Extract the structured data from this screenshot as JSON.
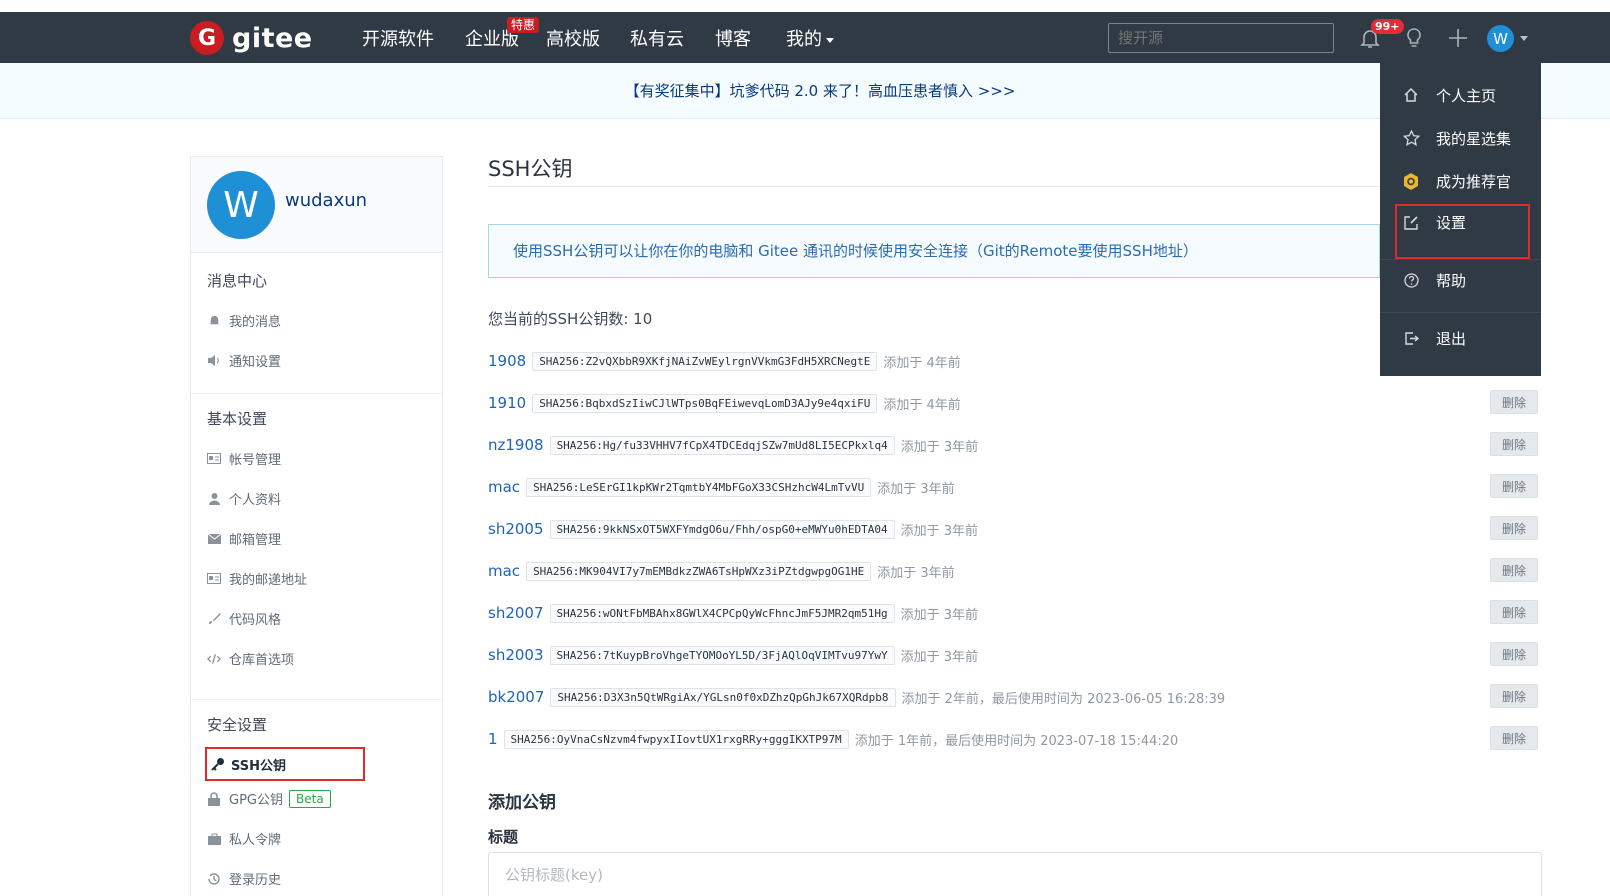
{
  "nav": {
    "logo_mark": "G",
    "logo_text": "gitee",
    "items": [
      "开源软件",
      "企业版",
      "高校版",
      "私有云",
      "博客",
      "我的"
    ],
    "hot_badge": "特惠",
    "search_placeholder": "搜开源",
    "notification_count": "99+",
    "avatar_letter": "W"
  },
  "promo": {
    "text": "【有奖征集中】坑爹代码 2.0 来了！高血压患者慎入 >>>"
  },
  "sidebar": {
    "avatar_letter": "W",
    "username": "wudaxun",
    "sections": [
      {
        "title": "消息中心",
        "items": [
          "我的消息",
          "通知设置"
        ]
      },
      {
        "title": "基本设置",
        "items": [
          "帐号管理",
          "个人资料",
          "邮箱管理",
          "我的邮递地址",
          "代码风格",
          "仓库首选项"
        ]
      },
      {
        "title": "安全设置",
        "items": [
          "SSH公钥",
          "GPG公钥",
          "私人令牌",
          "登录历史"
        ]
      }
    ],
    "beta_label": "Beta"
  },
  "main": {
    "title": "SSH公钥",
    "info": "使用SSH公钥可以让你在你的电脑和 Gitee 通讯的时候使用安全连接（Git的Remote要使用SSH地址）",
    "count_label": "您当前的SSH公钥数: 10",
    "delete_label": "删除",
    "keys": [
      {
        "name": "1908",
        "fp": "SHA256:Z2vQXbbR9XKfjNAiZvWEylrgnVVkmG3FdH5XRCNegtE",
        "added": "添加于 4年前"
      },
      {
        "name": "1910",
        "fp": "SHA256:BqbxdSzIiwCJlWTps0BqFEiwevqLomD3AJy9e4qxiFU",
        "added": "添加于 4年前"
      },
      {
        "name": "nz1908",
        "fp": "SHA256:Hg/fu33VHHV7fCpX4TDCEdqjSZw7mUd8LI5ECPkxlq4",
        "added": "添加于 3年前"
      },
      {
        "name": "mac",
        "fp": "SHA256:LeSErGI1kpKWr2TqmtbY4MbFGoX33CSHzhcW4LmTvVU",
        "added": "添加于 3年前"
      },
      {
        "name": "sh2005",
        "fp": "SHA256:9kkNSxOT5WXFYmdgO6u/Fhh/ospG0+eMWYu0hEDTA04",
        "added": "添加于 3年前"
      },
      {
        "name": "mac",
        "fp": "SHA256:MK904VI7y7mEMBdkzZWA6TsHpWXz3iPZtdgwpgOG1HE",
        "added": "添加于 3年前"
      },
      {
        "name": "sh2007",
        "fp": "SHA256:wONtFbMBAhx8GWlX4CPCpQyWcFhncJmF5JMR2qm51Hg",
        "added": "添加于 3年前"
      },
      {
        "name": "sh2003",
        "fp": "SHA256:7tKuypBroVhgeTYOMOoYL5D/3FjAQlOqVIMTvu97YwY",
        "added": "添加于 3年前"
      },
      {
        "name": "bk2007",
        "fp": "SHA256:D3X3n5QtWRgiAx/YGLsn0f0xDZhzQpGhJk67XQRdpb8",
        "added": "添加于 2年前，最后使用时间为 2023-06-05 16:28:39"
      },
      {
        "name": "1",
        "fp": "SHA256:OyVnaCsNzvm4fwpyxIIovtUX1rxgRRy+gggIKXTP97M",
        "added": "添加于 1年前，最后使用时间为 2023-07-18 15:44:20"
      }
    ],
    "add_title": "添加公钥",
    "field_label": "标题",
    "field_placeholder": "公钥标题(key)"
  },
  "dropdown": {
    "items": [
      "个人主页",
      "我的星选集",
      "成为推荐官",
      "设置",
      "帮助",
      "退出"
    ]
  },
  "colors": {
    "nav_bg": "#2f3a45",
    "brand_red": "#c71d23",
    "link_blue": "#1e64b5",
    "highlight_red": "#df2b2b"
  }
}
